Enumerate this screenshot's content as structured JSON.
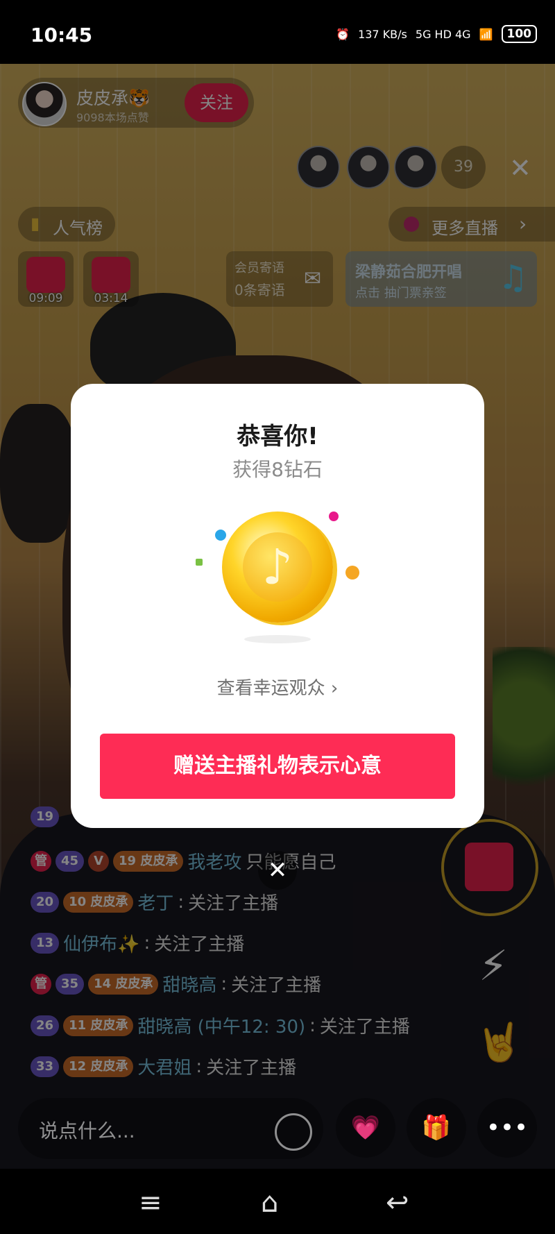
{
  "status_bar": {
    "time": "10:45",
    "net_speed": "137 KB/s",
    "network": "5G HD 4G",
    "battery": "100"
  },
  "host": {
    "name": "皮皮承🐯",
    "likes": "9098本场点赞",
    "follow_label": "关注"
  },
  "viewers": {
    "count": "39"
  },
  "ranking_label": "人气榜",
  "more_live_label": "更多直播",
  "timers": [
    "09:09",
    "03:14"
  ],
  "notice": {
    "title": "会员寄语",
    "value": "0条寄语"
  },
  "song": {
    "title": "梁静茹合肥开唱",
    "subtitle": "点击 抽门票亲签"
  },
  "chat": [
    {
      "badges": [
        "19"
      ],
      "user": "",
      "msg": ""
    },
    {
      "badges": [
        "管",
        "45",
        "V",
        "19 皮皮承"
      ],
      "user": "我老攻",
      "msg": "只能愿自己"
    },
    {
      "badges": [
        "20",
        "10 皮皮承"
      ],
      "user": "老丁",
      "msg": "关注了主播"
    },
    {
      "badges": [
        "13"
      ],
      "user": "仙伊布✨",
      "msg": "关注了主播"
    },
    {
      "badges": [
        "管",
        "35",
        "14 皮皮承"
      ],
      "user": "甜晓高",
      "msg": "关注了主播"
    },
    {
      "badges": [
        "26",
        "11 皮皮承"
      ],
      "user": "甜晓高 (中午12: 30)",
      "msg": "关注了主播"
    },
    {
      "badges": [
        "33",
        "12 皮皮承"
      ],
      "user": "大君姐",
      "msg": "关注了主播"
    }
  ],
  "input": {
    "placeholder": "说点什么..."
  },
  "modal": {
    "title": "恭喜你!",
    "subtitle": "获得8钻石",
    "lucky_link": "查看幸运观众 ›",
    "cta": "赠送主播礼物表示心意",
    "coin_icon": "coin-icon"
  },
  "colors": {
    "accent": "#fe2c55",
    "follow": "#e8214e"
  }
}
